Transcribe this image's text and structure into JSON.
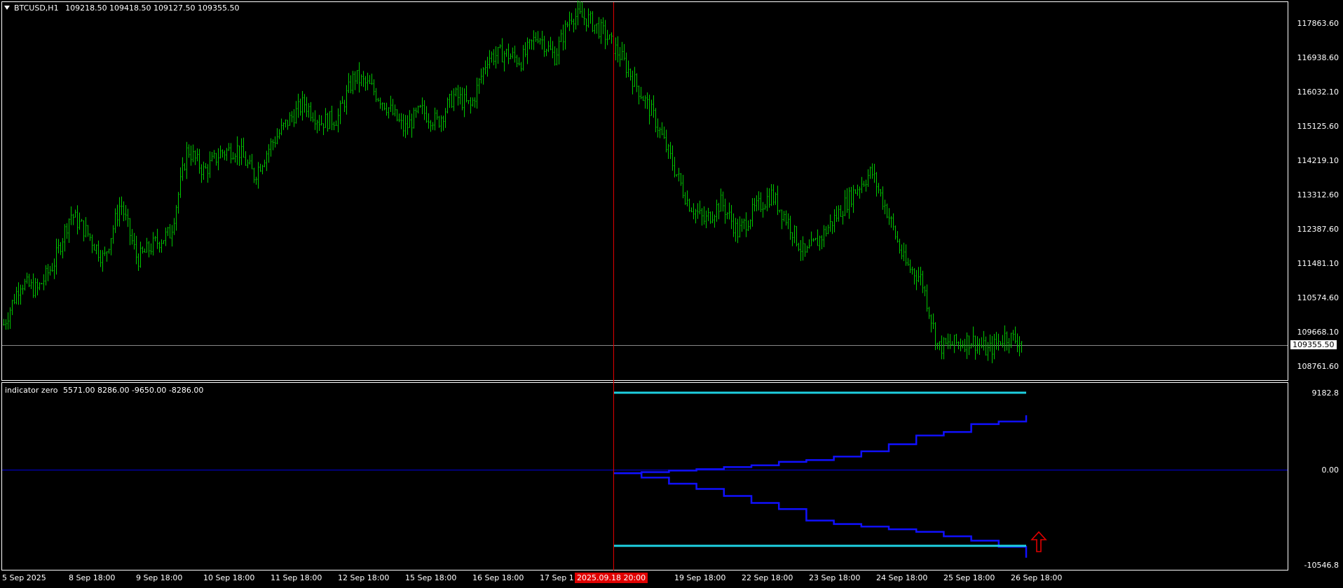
{
  "header": {
    "symbol": "BTCUSD,H1",
    "ohlc": "109218.50 109418.50 109127.50 109355.50"
  },
  "main_axis": {
    "labels": [
      "117863.60",
      "116938.60",
      "116032.10",
      "115125.60",
      "114219.10",
      "113312.60",
      "112387.60",
      "111481.10",
      "110574.60",
      "109668.10",
      "108761.60"
    ],
    "current_price": "109355.50"
  },
  "indicator": {
    "title": "indicator zero",
    "values": "5571.00 8286.00 -9650.00 -8286.00",
    "axis_labels": [
      "9182.8",
      "0.00",
      "-10546.8"
    ]
  },
  "time_axis": {
    "labels": [
      "5 Sep 2025",
      "8 Sep 18:00",
      "9 Sep 18:00",
      "10 Sep 18:00",
      "11 Sep 18:00",
      "12 Sep 18:00",
      "15 Sep 18:00",
      "16 Sep 18:00",
      "17 Sep 1",
      "19 Sep 18:00",
      "22 Sep 18:00",
      "23 Sep 18:00",
      "24 Sep 18:00",
      "25 Sep 18:00",
      "26 Sep 18:00"
    ],
    "cursor_time": "2025.09.18 20:00"
  },
  "colors": {
    "background": "#000000",
    "bars": "#00c800",
    "frame": "#ffffff",
    "cursor_line": "#e00000",
    "indicator_level": "#1ecfe0",
    "indicator_line": "#1010ff",
    "zero_line": "#0000a0",
    "arrow": "#e00000"
  },
  "chart_data": {
    "type": "line",
    "price_waypoints": [
      109800,
      110900,
      110700,
      111400,
      112700,
      112200,
      111500,
      113000,
      111500,
      111900,
      112200,
      114400,
      113800,
      114300,
      114400,
      113700,
      114500,
      115100,
      115600,
      115100,
      115200,
      116300,
      116000,
      115500,
      114900,
      115400,
      115100,
      115800,
      115500,
      116800,
      116900,
      116700,
      117400,
      116800,
      117900,
      117800,
      117400,
      116800,
      116000,
      115200,
      114100,
      113000,
      112500,
      113000,
      112200,
      112800,
      113200,
      112500,
      111600,
      112100,
      112700,
      113300,
      113800,
      112700,
      111400,
      111000,
      109200,
      109300,
      109400,
      109100,
      109500,
      109355
    ],
    "indicator_series": [
      {
        "values": [
          9182.8,
          9182.8
        ]
      },
      {
        "values": [
          0,
          120,
          300,
          450,
          700,
          900,
          1300,
          1500,
          1900,
          2500,
          3300,
          4300,
          4700,
          5600,
          5900,
          6600
        ]
      },
      {
        "values": [
          0,
          -500,
          -1200,
          -1800,
          -2600,
          -3400,
          -4100,
          -5400,
          -5800,
          -6100,
          -6400,
          -6700,
          -7200,
          -7700,
          -8400,
          -9650
        ]
      },
      {
        "values": [
          -8286,
          -8286
        ]
      }
    ],
    "y_range_price": [
      108400,
      118200
    ],
    "y_range_indicator": [
      -10546.8,
      9182.8
    ]
  }
}
